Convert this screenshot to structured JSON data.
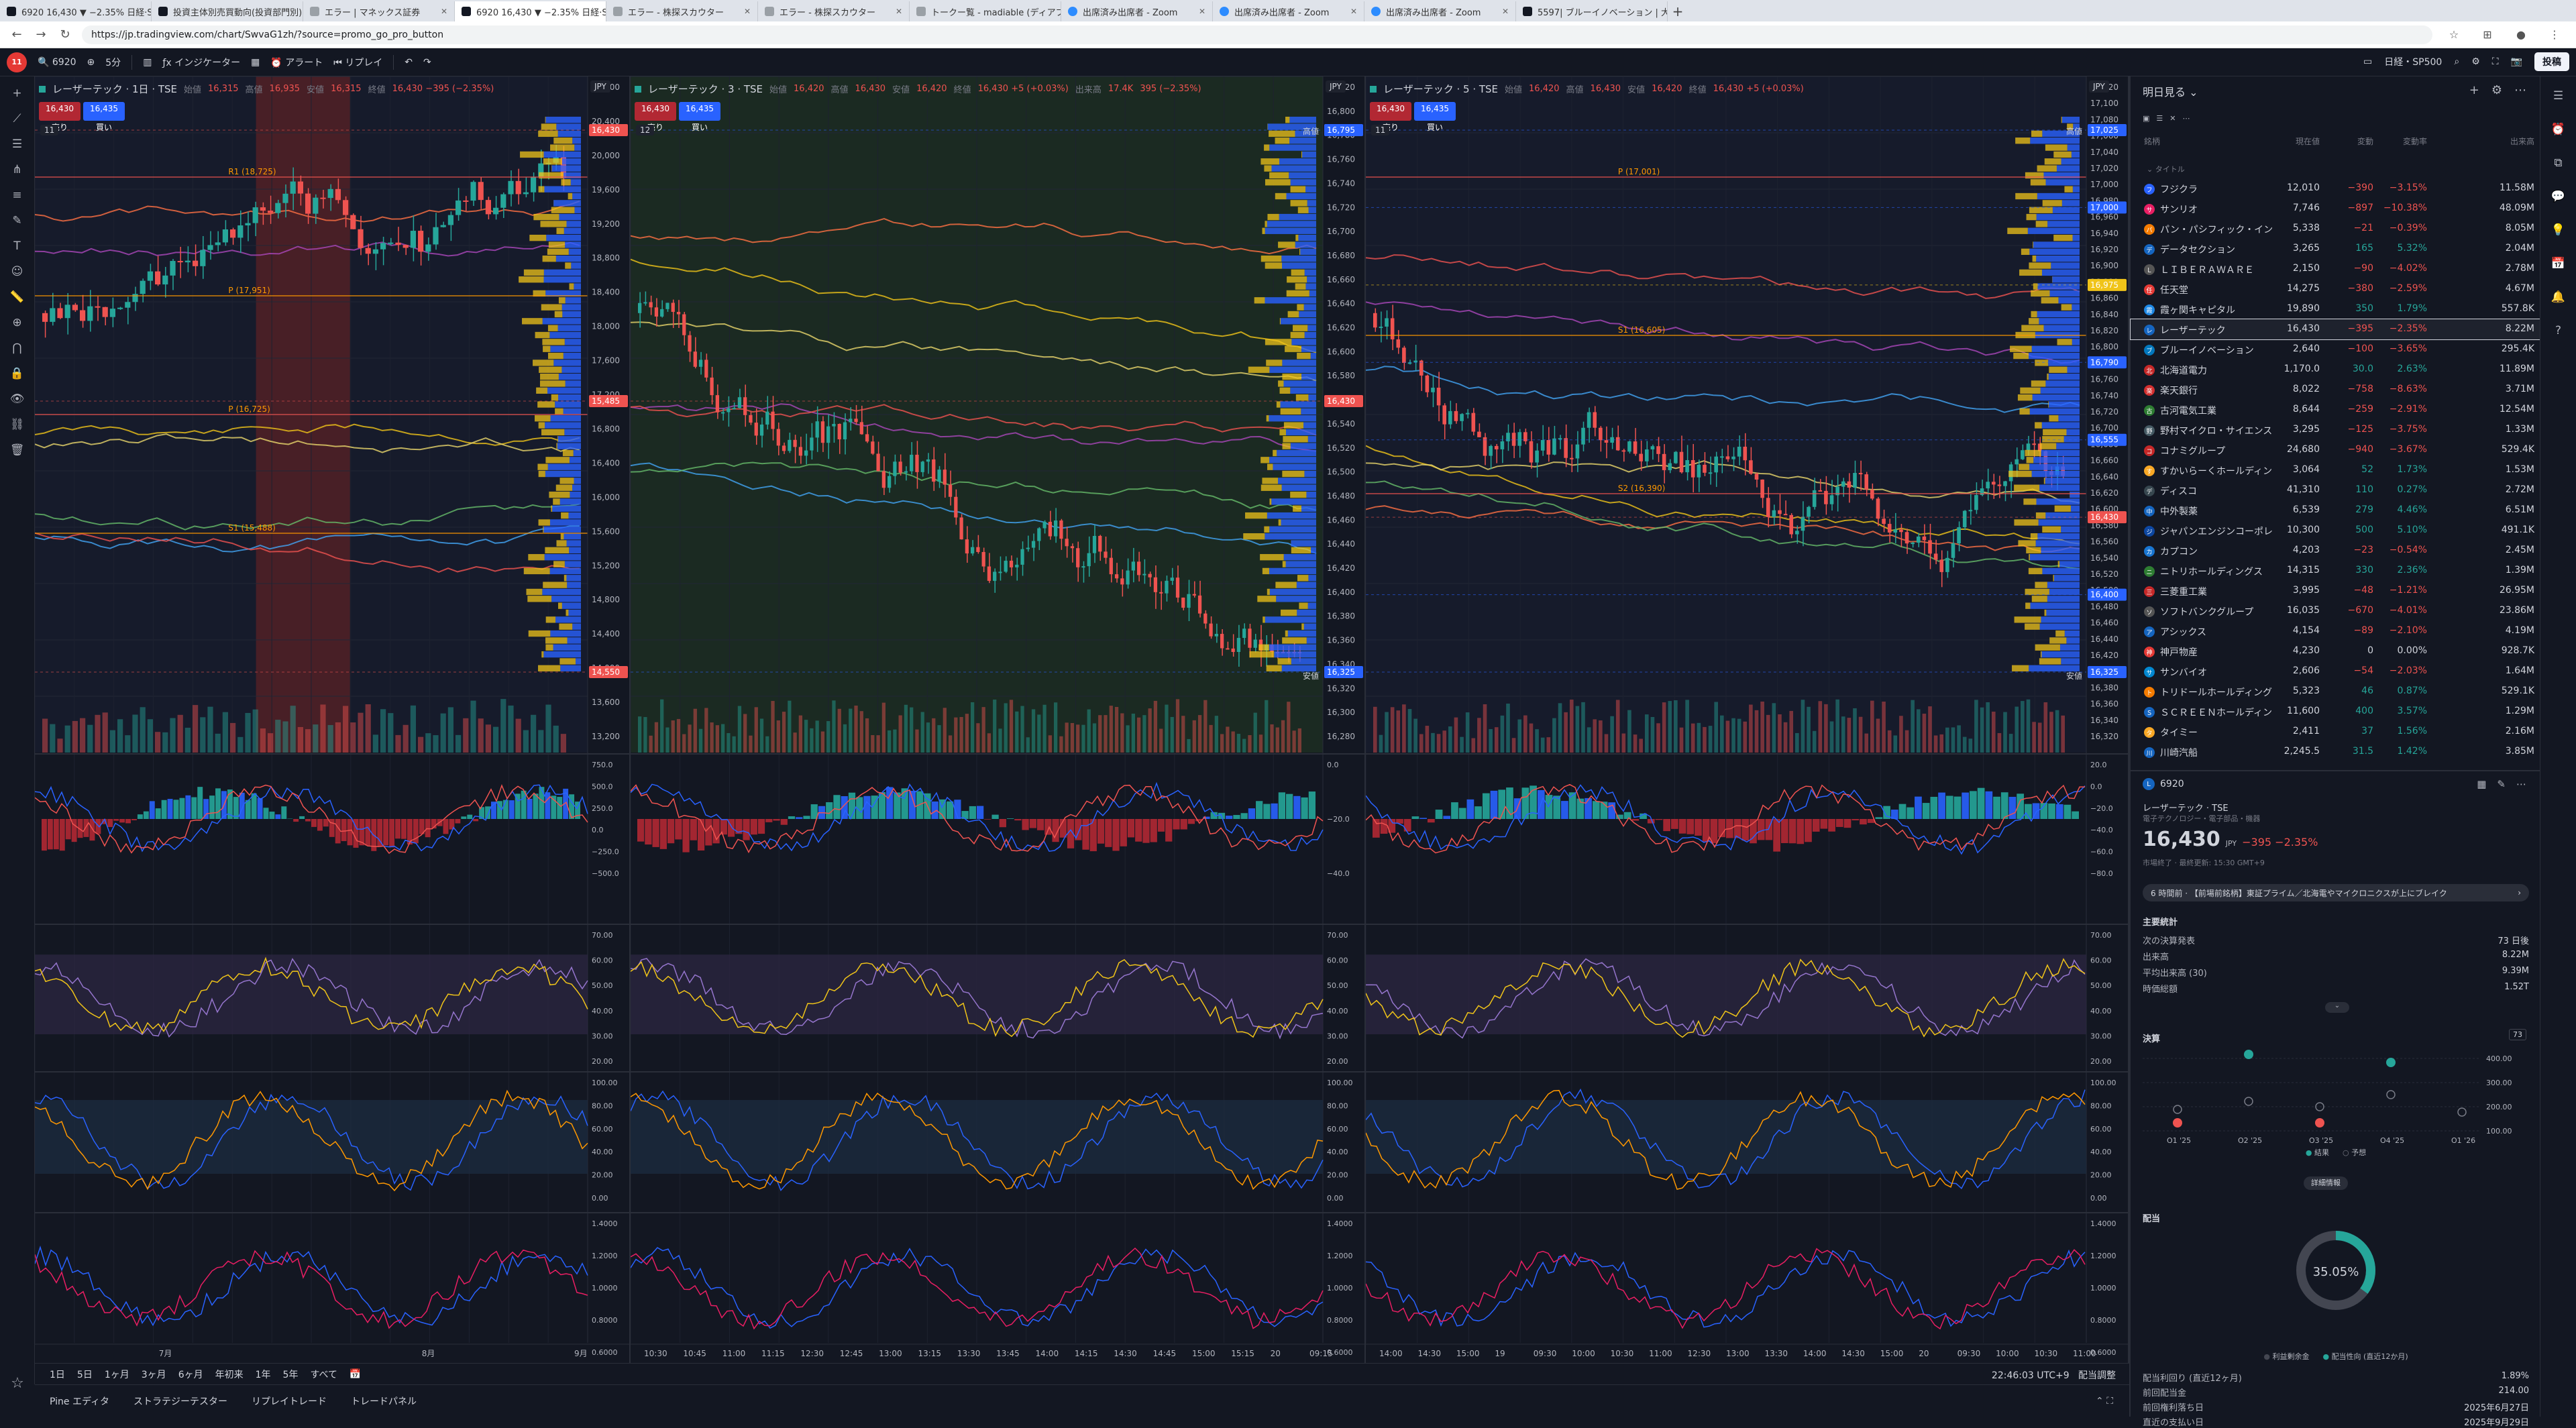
{
  "browser": {
    "tabs": [
      {
        "label": "6920 16,430 ▼ −2.35% 日経·SP5",
        "active": false
      },
      {
        "label": "投資主体別売買動向(投資部門別)",
        "active": false
      },
      {
        "label": "エラー | マネックス証券",
        "active": false
      },
      {
        "label": "6920 16,430 ▼ −2.35% 日経·SP5",
        "active": true
      },
      {
        "label": "エラー - 株探スカウター",
        "active": false
      },
      {
        "label": "エラー - 株探スカウター",
        "active": false
      },
      {
        "label": "トークー覧 - madiable (ディアブル)",
        "active": false
      },
      {
        "label": "出席済み出席者 - Zoom",
        "active": false
      },
      {
        "label": "出席済み出席者 - Zoom",
        "active": false
      },
      {
        "label": "出席済み出席者 - Zoom",
        "active": false
      },
      {
        "label": "5597| ブルーイノベーション | 大口の空",
        "active": false
      }
    ],
    "url": "https://jp.tradingview.com/chart/SwvaG1zh/?source=promo_go_pro_button"
  },
  "toolbar": {
    "symbol": "6920",
    "interval": "5分",
    "indicators": "インジケーター",
    "alert": "アラート",
    "replay": "リプレイ",
    "layout_label": "日経・SP500",
    "publish": "投稿"
  },
  "panes": [
    {
      "title": "レーザーテック · 1日 · TSE",
      "ohlc": [
        {
          "k": "始値",
          "v": "16,315"
        },
        {
          "k": "高値",
          "v": "16,935"
        },
        {
          "k": "安値",
          "v": "16,315"
        },
        {
          "k": "終値",
          "v": "16,430 −395 (−2.35%)"
        }
      ],
      "sell": "16,430",
      "buy": "16,435",
      "sell_label": "売り",
      "buy_label": "買い",
      "currency": "JPY",
      "ind_count": "11",
      "price_ticks": [
        "20,800",
        "20,400",
        "20,000",
        "19,600",
        "19,200",
        "18,800",
        "18,400",
        "18,000",
        "17,600",
        "17,200",
        "16,800",
        "16,400",
        "16,000",
        "15,600",
        "15,200",
        "14,800",
        "14,400",
        "14,000",
        "13,600",
        "13,200"
      ],
      "time_ticks": [
        "7月",
        "8月",
        "9月"
      ],
      "osc_ticks": [
        [
          "750.0",
          "500.0",
          "250.0",
          "0.0",
          "−250.0",
          "−500.0"
        ],
        [
          "70.00",
          "60.00",
          "50.00",
          "40.00",
          "30.00",
          "20.00"
        ],
        [
          "100.00",
          "80.00",
          "60.00",
          "40.00",
          "20.00",
          "0.00"
        ],
        [
          "1.4000",
          "1.2000",
          "1.0000",
          "0.8000",
          "0.6000"
        ]
      ],
      "levels": [
        {
          "label": "R1 (18,725)"
        },
        {
          "label": "P (17,951)"
        },
        {
          "label": "P (16,725)"
        },
        {
          "label": "S1 (15,488)"
        }
      ],
      "price_tags": [
        {
          "v": "16,430",
          "c": "#ef5350"
        },
        {
          "v": "15,485",
          "c": "#ef5350"
        },
        {
          "v": "14,550",
          "c": "#ef5350"
        }
      ],
      "seed": 11
    },
    {
      "title": "レーザーテック · 3 · TSE",
      "ohlc": [
        {
          "k": "始値",
          "v": "16,420"
        },
        {
          "k": "高値",
          "v": "16,430"
        },
        {
          "k": "安値",
          "v": "16,420"
        },
        {
          "k": "終値",
          "v": "16,430 +5 (+0.03%)"
        },
        {
          "k": "出来高",
          "v": "17.4K"
        },
        {
          "k": "",
          "v": "395 (−2.35%)"
        }
      ],
      "sell": "16,430",
      "buy": "16,435",
      "sell_label": "売り",
      "buy_label": "買い",
      "currency": "JPY",
      "ind_count": "12",
      "price_ticks": [
        "16,820",
        "16,800",
        "16,780",
        "16,760",
        "16,740",
        "16,720",
        "16,700",
        "16,680",
        "16,660",
        "16,640",
        "16,620",
        "16,600",
        "16,580",
        "16,560",
        "16,540",
        "16,520",
        "16,500",
        "16,480",
        "16,460",
        "16,440",
        "16,420",
        "16,400",
        "16,380",
        "16,360",
        "16,340",
        "16,320",
        "16,300",
        "16,280"
      ],
      "time_ticks": [
        "10:30",
        "10:45",
        "11:00",
        "11:15",
        "12:30",
        "12:45",
        "13:00",
        "13:15",
        "13:30",
        "13:45",
        "14:00",
        "14:15",
        "14:30",
        "14:45",
        "15:00",
        "15:15",
        "20",
        "09:15"
      ],
      "osc_ticks": [
        [
          "0.0",
          "−20.0",
          "−40.0"
        ],
        [
          "70.00",
          "60.00",
          "50.00",
          "40.00",
          "30.00",
          "20.00"
        ],
        [
          "100.00",
          "80.00",
          "60.00",
          "40.00",
          "20.00",
          "0.00"
        ],
        [
          "1.4000",
          "1.2000",
          "1.0000",
          "0.8000",
          "0.6000"
        ]
      ],
      "levels": [],
      "price_tags": [
        {
          "v": "16,795",
          "c": "#2962ff"
        },
        {
          "v": "16,430",
          "c": "#ef5350"
        },
        {
          "v": "16,325",
          "c": "#2962ff"
        }
      ],
      "hi_label": "高値",
      "lo_label": "安値",
      "seed": 23
    },
    {
      "title": "レーザーテック · 5 · TSE",
      "ohlc": [
        {
          "k": "始値",
          "v": "16,420"
        },
        {
          "k": "高値",
          "v": "16,430"
        },
        {
          "k": "安値",
          "v": "16,420"
        },
        {
          "k": "終値",
          "v": "16,430 +5 (+0.03%)"
        }
      ],
      "sell": "16,430",
      "buy": "16,435",
      "sell_label": "売り",
      "buy_label": "買い",
      "currency": "JPY",
      "ind_count": "11",
      "price_ticks": [
        "17,120",
        "17,100",
        "17,080",
        "17,060",
        "17,040",
        "17,020",
        "17,000",
        "16,980",
        "16,960",
        "16,940",
        "16,920",
        "16,900",
        "16,880",
        "16,860",
        "16,840",
        "16,820",
        "16,800",
        "16,780",
        "16,760",
        "16,740",
        "16,720",
        "16,700",
        "16,680",
        "16,660",
        "16,640",
        "16,620",
        "16,600",
        "16,580",
        "16,560",
        "16,540",
        "16,520",
        "16,500",
        "16,480",
        "16,460",
        "16,440",
        "16,420",
        "16,400",
        "16,380",
        "16,360",
        "16,340",
        "16,320"
      ],
      "time_ticks": [
        "14:00",
        "14:30",
        "15:00",
        "19",
        "09:30",
        "10:00",
        "10:30",
        "11:00",
        "12:30",
        "13:00",
        "13:30",
        "14:00",
        "14:30",
        "15:00",
        "20",
        "09:30",
        "10:00",
        "10:30",
        "11:00"
      ],
      "osc_ticks": [
        [
          "20.0",
          "0.0",
          "−20.0",
          "−40.0",
          "−60.0",
          "−80.0"
        ],
        [
          "70.00",
          "60.00",
          "50.00",
          "40.00",
          "30.00",
          "20.00"
        ],
        [
          "100.00",
          "80.00",
          "60.00",
          "40.00",
          "20.00",
          "0.00"
        ],
        [
          "1.4000",
          "1.2000",
          "1.0000",
          "0.8000",
          "0.6000"
        ]
      ],
      "levels": [
        {
          "label": "P (17,001)"
        },
        {
          "label": "S1 (16,605)"
        },
        {
          "label": "S2 (16,390)"
        }
      ],
      "price_tags": [
        {
          "v": "17,025",
          "c": "#2962ff"
        },
        {
          "v": "17,000",
          "c": "#2962ff"
        },
        {
          "v": "16,975",
          "c": "#f0c419"
        },
        {
          "v": "16,790",
          "c": "#2962ff"
        },
        {
          "v": "16,555",
          "c": "#2962ff"
        },
        {
          "v": "16,430",
          "c": "#ef5350"
        },
        {
          "v": "16,400",
          "c": "#2962ff"
        },
        {
          "v": "16,325",
          "c": "#2962ff"
        }
      ],
      "hi_label": "高値",
      "lo_label": "安値",
      "seed": 37
    }
  ],
  "timebar": {
    "ranges": [
      "1日",
      "5日",
      "1ヶ月",
      "3ヶ月",
      "6ヶ月",
      "年初来",
      "1年",
      "5年",
      "すべて"
    ],
    "clock": "22:46:03 UTC+9",
    "adj": "配当調整"
  },
  "bottom_tabs": [
    "Pine エディタ",
    "ストラテジーテスター",
    "リプレイトレード",
    "トレードパネル"
  ],
  "watchlist": {
    "title": "明日見る",
    "columns": {
      "sym": "銘柄",
      "last": "現在値",
      "chg": "変動",
      "chgp": "変動率",
      "vol": "出来高"
    },
    "section": "タイトル",
    "rows": [
      {
        "name": "フジクラ",
        "last": "12,010",
        "chg": "−390",
        "chgp": "−3.15%",
        "vol": "11.58M",
        "ic": "#2962ff",
        "dir": "dn"
      },
      {
        "name": "サンリオ",
        "last": "7,746",
        "chg": "−897",
        "chgp": "−10.38%",
        "vol": "48.09M",
        "ic": "#e91e63",
        "dir": "dn"
      },
      {
        "name": "パン・パシフィック・イン",
        "last": "5,338",
        "chg": "−21",
        "chgp": "−0.39%",
        "vol": "8.05M",
        "ic": "#f57c00",
        "dir": "dn"
      },
      {
        "name": "データセクション",
        "last": "3,265",
        "chg": "165",
        "chgp": "5.32%",
        "vol": "2.04M",
        "ic": "#1565c0",
        "dir": "up"
      },
      {
        "name": "ＬＩＢＥＲＡＷＡＲＥ",
        "last": "2,150",
        "chg": "−90",
        "chgp": "−4.02%",
        "vol": "2.78M",
        "ic": "#555",
        "dir": "dn"
      },
      {
        "name": "任天堂",
        "last": "14,275",
        "chg": "−380",
        "chgp": "−2.59%",
        "vol": "4.67M",
        "ic": "#e53935",
        "dir": "dn"
      },
      {
        "name": "霞ヶ関キャピタル",
        "last": "19,890",
        "chg": "350",
        "chgp": "1.79%",
        "vol": "557.8K",
        "ic": "#1e88e5",
        "dir": "up"
      },
      {
        "name": "レーザーテック",
        "last": "16,430",
        "chg": "−395",
        "chgp": "−2.35%",
        "vol": "8.22M",
        "ic": "#1565c0",
        "dir": "dn",
        "sel": true
      },
      {
        "name": "ブルーイノベーション",
        "last": "2,640",
        "chg": "−100",
        "chgp": "−3.65%",
        "vol": "295.4K",
        "ic": "#0277bd",
        "dir": "dn"
      },
      {
        "name": "北海道電力",
        "last": "1,170.0",
        "chg": "30.0",
        "chgp": "2.63%",
        "vol": "11.89M",
        "ic": "#c62828",
        "dir": "up"
      },
      {
        "name": "楽天銀行",
        "last": "8,022",
        "chg": "−758",
        "chgp": "−8.63%",
        "vol": "3.71M",
        "ic": "#d32f2f",
        "dir": "dn"
      },
      {
        "name": "古河電気工業",
        "last": "8,644",
        "chg": "−259",
        "chgp": "−2.91%",
        "vol": "12.54M",
        "ic": "#2e7d32",
        "dir": "dn"
      },
      {
        "name": "野村マイクロ・サイエンス",
        "last": "3,295",
        "chg": "−125",
        "chgp": "−3.75%",
        "vol": "1.33M",
        "ic": "#455a64",
        "dir": "dn"
      },
      {
        "name": "コナミグループ",
        "last": "24,680",
        "chg": "−940",
        "chgp": "−3.67%",
        "vol": "529.4K",
        "ic": "#c62828",
        "dir": "dn"
      },
      {
        "name": "すかいらーくホールディン",
        "last": "3,064",
        "chg": "52",
        "chgp": "1.73%",
        "vol": "1.53M",
        "ic": "#f9a825",
        "dir": "up"
      },
      {
        "name": "ディスコ",
        "last": "41,310",
        "chg": "110",
        "chgp": "0.27%",
        "vol": "2.72M",
        "ic": "#37474f",
        "dir": "up"
      },
      {
        "name": "中外製薬",
        "last": "6,539",
        "chg": "279",
        "chgp": "4.46%",
        "vol": "6.51M",
        "ic": "#1565c0",
        "dir": "up"
      },
      {
        "name": "ジャパンエンジンコーポレ",
        "last": "10,300",
        "chg": "500",
        "chgp": "5.10%",
        "vol": "491.1K",
        "ic": "#0d47a1",
        "dir": "up"
      },
      {
        "name": "カプコン",
        "last": "4,203",
        "chg": "−23",
        "chgp": "−0.54%",
        "vol": "2.45M",
        "ic": "#1976d2",
        "dir": "dn"
      },
      {
        "name": "ニトリホールディングス",
        "last": "14,315",
        "chg": "330",
        "chgp": "2.36%",
        "vol": "1.39M",
        "ic": "#2e7d32",
        "dir": "up"
      },
      {
        "name": "三菱重工業",
        "last": "3,995",
        "chg": "−48",
        "chgp": "−1.21%",
        "vol": "26.95M",
        "ic": "#c62828",
        "dir": "dn"
      },
      {
        "name": "ソフトバンクグループ",
        "last": "16,035",
        "chg": "−670",
        "chgp": "−4.01%",
        "vol": "23.86M",
        "ic": "#555",
        "dir": "dn"
      },
      {
        "name": "アシックス",
        "last": "4,154",
        "chg": "−89",
        "chgp": "−2.10%",
        "vol": "4.19M",
        "ic": "#1565c0",
        "dir": "dn"
      },
      {
        "name": "神戸物産",
        "last": "4,230",
        "chg": "0",
        "chgp": "0.00%",
        "vol": "928.7K",
        "ic": "#e53935",
        "dir": "flat"
      },
      {
        "name": "サンバイオ",
        "last": "2,606",
        "chg": "−54",
        "chgp": "−2.03%",
        "vol": "1.64M",
        "ic": "#0288d1",
        "dir": "dn"
      },
      {
        "name": "トリドールホールディング",
        "last": "5,323",
        "chg": "46",
        "chgp": "0.87%",
        "vol": "529.1K",
        "ic": "#f57c00",
        "dir": "up"
      },
      {
        "name": "ＳＣＲＥＥＮホールディン",
        "last": "11,600",
        "chg": "400",
        "chgp": "3.57%",
        "vol": "1.29M",
        "ic": "#1565c0",
        "dir": "up"
      },
      {
        "name": "タイミー",
        "last": "2,411",
        "chg": "37",
        "chgp": "1.56%",
        "vol": "2.16M",
        "ic": "#f9a825",
        "dir": "up"
      },
      {
        "name": "川崎汽船",
        "last": "2,245.5",
        "chg": "31.5",
        "chgp": "1.42%",
        "vol": "3.85M",
        "ic": "#1565c0",
        "dir": "up"
      }
    ]
  },
  "details": {
    "ticker": "6920",
    "name": "レーザーテック",
    "exchange": "TSE",
    "category": "電子テクノロジー・電子部品・機器",
    "price": "16,430",
    "currency": "JPY",
    "change": "−395 −2.35%",
    "status": "市場終了 · 最終更新: 15:30 GMT+9",
    "news": "6 時間前 · 【前場前銘柄】東証プライム／北海電やマイクロニクスが上にブレイク",
    "key_stats_title": "主要統計",
    "stats": [
      {
        "k": "次の決算発表",
        "v": "73 日後"
      },
      {
        "k": "出来高",
        "v": "8.22M"
      },
      {
        "k": "平均出来高 (30)",
        "v": "9.39M"
      },
      {
        "k": "時価総額",
        "v": "1.52T"
      }
    ],
    "earnings_title": "決算",
    "earnings_badge": "73",
    "earn_yticks": [
      "400.00",
      "300.00",
      "200.00",
      "100.00"
    ],
    "earn_quarters": [
      "Q1 '25",
      "Q2 '25",
      "Q3 '25",
      "Q4 '25",
      "Q1 '26"
    ],
    "earn_legend": [
      "結果",
      "予想"
    ],
    "earn_button": "詳細情報",
    "dividends_title": "配当",
    "payout": "35.05%",
    "payout_value": 35.05,
    "div_legend": [
      "利益剰余金",
      "配当性向 (直近12か月)"
    ],
    "div_stats": [
      {
        "k": "配当利回り (直近12ヶ月)",
        "v": "1.89%"
      },
      {
        "k": "前回配当金",
        "v": "214.00"
      },
      {
        "k": "前回権利落ち日",
        "v": "2025年6月27日"
      },
      {
        "k": "直近の支払い日",
        "v": "2025年9月29日"
      }
    ]
  },
  "colors": {
    "bg": "#131722",
    "up": "#26a69a",
    "down": "#ef5350",
    "accent": "#2962ff",
    "gold": "#f0c419"
  }
}
